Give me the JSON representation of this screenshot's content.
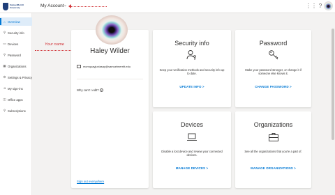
{
  "header": {
    "logo_text": "SamuelMerritt University",
    "title": "My Account",
    "icons": [
      "apps-icon",
      "help-icon"
    ],
    "avatar": "profile-avatar"
  },
  "sidebar": {
    "items": [
      {
        "label": "Overview",
        "icon": "home-icon",
        "active": true
      },
      {
        "label": "Security info",
        "icon": "security-icon"
      },
      {
        "label": "Devices",
        "icon": "laptop-icon"
      },
      {
        "label": "Password",
        "icon": "key-icon"
      },
      {
        "label": "Organizations",
        "icon": "briefcase-icon"
      },
      {
        "label": "Settings & Privacy",
        "icon": "gear-icon"
      },
      {
        "label": "My sign-ins",
        "icon": "signin-icon"
      },
      {
        "label": "Office apps",
        "icon": "office-icon"
      },
      {
        "label": "Subscriptions",
        "icon": "key-icon"
      }
    ]
  },
  "annotation": {
    "label": "Your name"
  },
  "profile": {
    "name": "Haley Wilder",
    "email": "mcmquayjuniasay@samuelmerritt.edu",
    "why_text": "Why can't I edit?",
    "signout": "Sign out everywhere"
  },
  "cards": {
    "security": {
      "title": "Security info",
      "desc": "Keep your verification methods and security info up to date.",
      "link": "UPDATE INFO >"
    },
    "password": {
      "title": "Password",
      "desc": "Make your password stronger, or change it if someone else knows it.",
      "link": "CHANGE PASSWORD >"
    },
    "devices": {
      "title": "Devices",
      "desc": "Disable a lost device and review your connected devices.",
      "link": "MANAGE DEVICES >"
    },
    "organizations": {
      "title": "Organizations",
      "desc": "See all the organizations that you're a part of.",
      "link": "MANAGE ORGANIZATIONS >"
    }
  },
  "colors": {
    "accent": "#0078d4",
    "annotation": "#d13438"
  }
}
